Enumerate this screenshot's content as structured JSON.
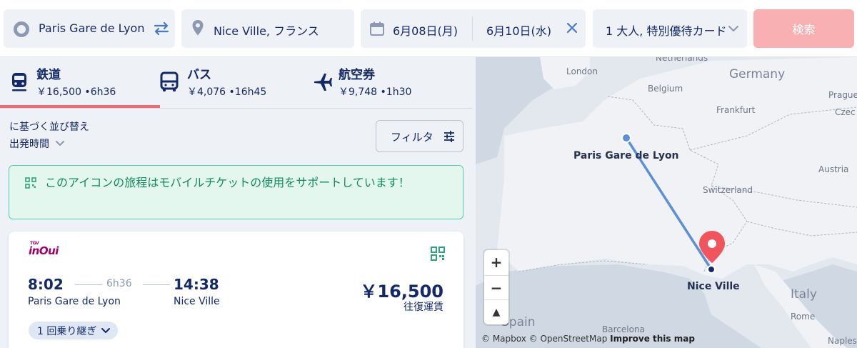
{
  "search": {
    "from": "Paris Gare de Lyon",
    "to": "Nice Ville, フランス",
    "date_out": "6月08日(月)",
    "date_return": "6月10日(水)",
    "passengers": "1 大人, 特別優待カード",
    "search_button": "検索"
  },
  "tabs": [
    {
      "name": "鉄道",
      "meta": "￥16,500 •6h36",
      "icon": "train-icon"
    },
    {
      "name": "バス",
      "meta": "￥4,076 •16h45",
      "icon": "bus-icon"
    },
    {
      "name": "航空券",
      "meta": "￥9,748 •1h30",
      "icon": "plane-icon"
    }
  ],
  "sort": {
    "label": "に基づく並び替え",
    "value": "出発時間"
  },
  "filter": {
    "label": "フィルタ"
  },
  "notice": {
    "message": "このアイコンの旅程はモバイルチケットの使用をサポートしています！"
  },
  "result": {
    "operator": "inOui",
    "operator_small": "TGV",
    "dep_time": "8:02",
    "duration": "6h36",
    "arr_time": "14:38",
    "dep_station": "Paris Gare de Lyon",
    "arr_station": "Nice Ville",
    "price": "￥16,500",
    "price_note": "往復運賃",
    "transfers": "1 回乗り継ぎ"
  },
  "map": {
    "labels": {
      "netherlands": "Netherlands",
      "london": "London",
      "germany": "Germany",
      "belgium": "Belgium",
      "prague": "Prague",
      "czech": "Czec",
      "frankfurt": "Frankfurt",
      "austria": "Austria",
      "switzerland": "Switzerland",
      "italy": "Italy",
      "rome": "Rome",
      "barcelona": "Barcelona",
      "spain": "Spain",
      "naples": "Naples"
    },
    "origin": "Paris Gare de Lyon",
    "destination": "Nice Ville",
    "zoom_in": "+",
    "zoom_out": "−",
    "compass": "▲",
    "attribution_mapbox": "© Mapbox",
    "attribution_osm": "© OpenStreetMap",
    "attribution_improve": "Improve this map"
  },
  "colors": {
    "brand_navy": "#132968",
    "search_button": "#f9b0b2",
    "tab_underline": "#f36b72",
    "notice_green": "#138a63",
    "route_line": "#5b8fd6",
    "pin_red": "#f0555e"
  }
}
